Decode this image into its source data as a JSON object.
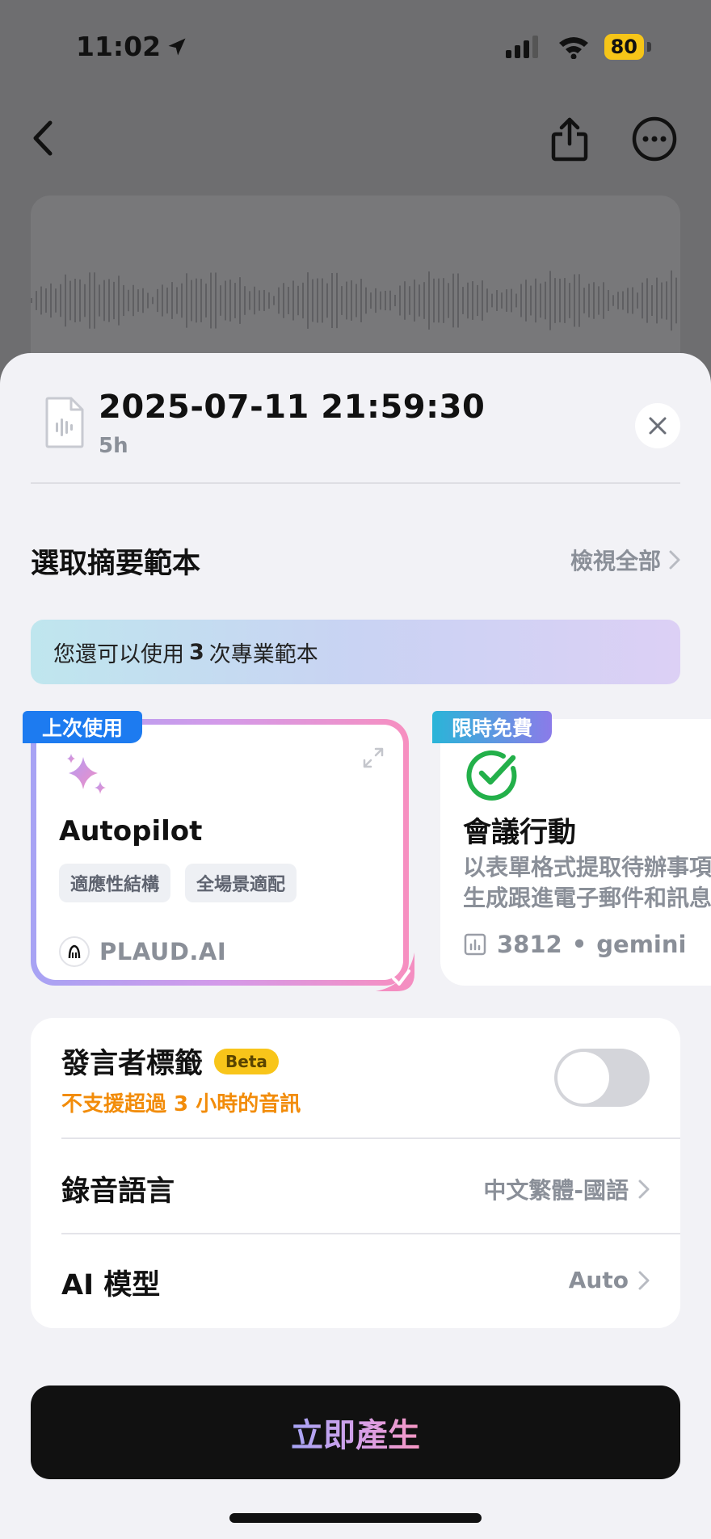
{
  "status_bar": {
    "time": "11:02",
    "battery": "80"
  },
  "recording": {
    "title": "2025-07-11 21:59:30",
    "duration": "5h"
  },
  "template_section": {
    "title": "選取摘要範本",
    "view_all": "檢視全部"
  },
  "quota": {
    "prefix": "您還可以使用",
    "count": "3",
    "suffix": "次專業範本"
  },
  "templates": [
    {
      "tag": "上次使用",
      "name": "Autopilot",
      "chips": [
        "適應性結構",
        "全場景適配"
      ],
      "provider": "PLAUD.AI",
      "selected": true
    },
    {
      "tag": "限時免費",
      "name": "會議行動",
      "description_lines": [
        "以表單格式提取待辦事項",
        "生成跟進電子郵件和訊息"
      ],
      "uses": "3812",
      "separator": "•",
      "model": "gemini",
      "selected": false
    }
  ],
  "settings": {
    "speaker": {
      "label": "發言者標籤",
      "badge": "Beta",
      "warning": "不支援超過 3 小時的音訊",
      "enabled": false
    },
    "language": {
      "label": "錄音語言",
      "value": "中文繁體-國語"
    },
    "model": {
      "label": "AI 模型",
      "value": "Auto"
    }
  },
  "generate_button": {
    "label": "立即產生"
  },
  "colors": {
    "accent_blue": "#1d7bf0",
    "warning_orange": "#f28c0a",
    "beta_yellow": "#f8c51a"
  }
}
